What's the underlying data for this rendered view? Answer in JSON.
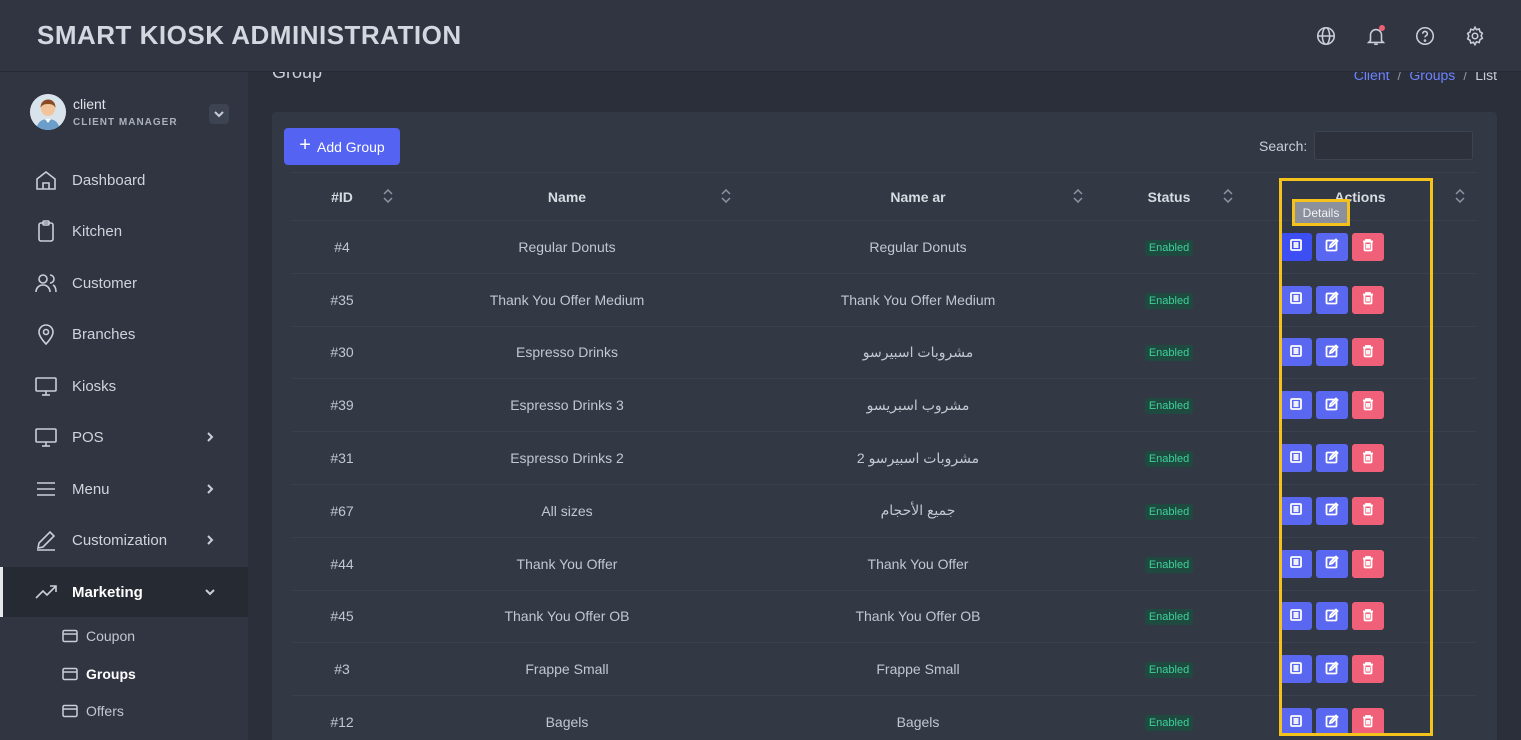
{
  "header": {
    "title": "SMART KIOSK ADMINISTRATION",
    "icons": [
      "globe-icon",
      "bell-icon",
      "help-icon",
      "gear-icon"
    ]
  },
  "user": {
    "name": "client",
    "role": "CLIENT MANAGER"
  },
  "sidebar": {
    "items": [
      {
        "label": "Dashboard",
        "icon": "home-icon"
      },
      {
        "label": "Kitchen",
        "icon": "clipboard-icon"
      },
      {
        "label": "Customer",
        "icon": "users-icon"
      },
      {
        "label": "Branches",
        "icon": "map-pin-icon"
      },
      {
        "label": "Kiosks",
        "icon": "monitor-icon"
      },
      {
        "label": "POS",
        "icon": "monitor-icon"
      },
      {
        "label": "Menu",
        "icon": "menu-icon"
      },
      {
        "label": "Customization",
        "icon": "pen-icon"
      },
      {
        "label": "Marketing",
        "icon": "trending-up-icon"
      }
    ],
    "subitems": [
      {
        "label": "Coupon"
      },
      {
        "label": "Groups"
      },
      {
        "label": "Offers"
      }
    ]
  },
  "page": {
    "title": "Group",
    "breadcrumb": {
      "client": "Client",
      "groups": "Groups",
      "current": "List"
    }
  },
  "toolbar": {
    "add_label": "Add Group",
    "search_label": "Search:",
    "search_value": ""
  },
  "table": {
    "headers": {
      "id": "#ID",
      "name": "Name",
      "name_ar": "Name ar",
      "status": "Status",
      "actions": "Actions"
    },
    "tooltip": "Details",
    "rows": [
      {
        "id": "#4",
        "name": "Regular Donuts",
        "name_ar": "Regular Donuts",
        "status": "Enabled"
      },
      {
        "id": "#35",
        "name": "Thank You Offer Medium",
        "name_ar": "Thank You Offer Medium",
        "status": "Enabled"
      },
      {
        "id": "#30",
        "name": "Espresso Drinks",
        "name_ar": "مشروبات اسبيرسو",
        "status": "Enabled"
      },
      {
        "id": "#39",
        "name": "Espresso Drinks 3",
        "name_ar": "مشروب اسبريسو",
        "status": "Enabled"
      },
      {
        "id": "#31",
        "name": "Espresso Drinks 2",
        "name_ar": "مشروبات اسبيرسو 2",
        "status": "Enabled"
      },
      {
        "id": "#67",
        "name": "All sizes",
        "name_ar": "جميع الأحجام",
        "status": "Enabled"
      },
      {
        "id": "#44",
        "name": "Thank You Offer",
        "name_ar": "Thank You Offer",
        "status": "Enabled"
      },
      {
        "id": "#45",
        "name": "Thank You Offer OB",
        "name_ar": "Thank You Offer OB",
        "status": "Enabled"
      },
      {
        "id": "#3",
        "name": "Frappe Small",
        "name_ar": "Frappe Small",
        "status": "Enabled"
      },
      {
        "id": "#12",
        "name": "Bagels",
        "name_ar": "Bagels",
        "status": "Enabled"
      }
    ]
  },
  "colors": {
    "primary": "#5463f2",
    "danger": "#f06078",
    "success": "#3fd19a",
    "highlight": "#f5c21b"
  }
}
